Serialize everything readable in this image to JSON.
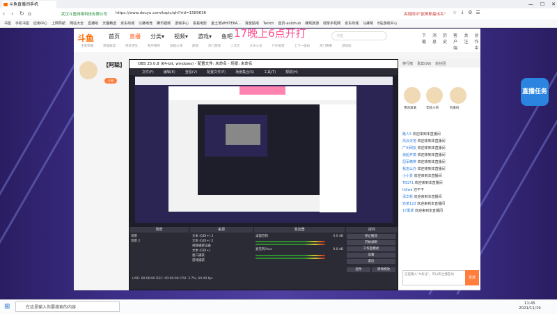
{
  "browser": {
    "tab_title": "斗鱼直播间手机",
    "secure_label": "武汉斗鱼网络科技有限公司",
    "url": "https://www.douyu.com/topic/qhl?rid=1589636",
    "right_notice": "央视回评\"欧美斯最出名\"",
    "window_controls": [
      "—",
      "☐",
      "✕"
    ],
    "nav_icons": [
      "‹",
      "›",
      "↻",
      "⌂"
    ],
    "toolbar_icons": [
      "☆",
      "↓",
      "⚙",
      "☰"
    ]
  },
  "bookmarks": [
    "书签",
    "手机书签",
    "应用中心",
    "上网导航",
    "网站大全",
    "直播吧",
    "天猫精选",
    "京东商城",
    "公路电竞",
    "腾讯视频",
    "游戏中心",
    "看看电影",
    "金土地WHITEKA...",
    "百度贴吧",
    "Twitch",
    "首页-autohub",
    "蜂窝旅游",
    "绿茶手机网",
    "京东商城",
    "马蜂窝",
    "B站游戏中心"
  ],
  "douyu": {
    "logo": "斗鱼",
    "overlay_text": "17晚上6点开打",
    "nav": [
      "首页",
      "直播",
      "分类▾",
      "视频▾",
      "游戏▾",
      "鱼吧"
    ],
    "active_nav": "直播",
    "search_placeholder": "卡位",
    "right_nav": [
      "下载",
      "消息",
      "历史",
      "客户端",
      "关注",
      "创作中心"
    ],
    "sub_nav": [
      "王者荣耀",
      "英雄联盟",
      "绝地求生",
      "和平精英",
      "穿越火线",
      "颜值",
      "热门游戏",
      "二次元",
      "大乐斗龙",
      "户外旅游",
      "上下一级站",
      "热门赛事",
      "游戏站"
    ]
  },
  "room": {
    "streamer_name": "【阿聪】",
    "follow_button": "订阅"
  },
  "obs": {
    "title": "OBS 25.0.8 (64-bit, windows) - 配置文件: 未命名 - 场景: 未命名",
    "menu": [
      "文件(F)",
      "编辑(E)",
      "查看(V)",
      "配置文件(P)",
      "场景集合(S)",
      "工具(T)",
      "帮助(H)"
    ],
    "panel_titles": [
      "场景",
      "来源",
      "混音器",
      "控件"
    ],
    "scenes": [
      "场景",
      "场景 2"
    ],
    "sources": [
      "文本 (GDI+) 3",
      "文本 (GDI+) 2",
      "视频捕获设备",
      "文本 (GDI+)",
      "窗口捕获",
      "游戏捕获"
    ],
    "mixer": [
      {
        "name": "桌面音频",
        "level": "0.0 dB"
      },
      {
        "name": "麦克风/Aux",
        "level": "0.0 dB"
      }
    ],
    "controls": [
      "停止推流",
      "开始录制",
      "工作室模式",
      "设置",
      "退出"
    ],
    "transition_tabs": [
      "控件",
      "转场特效"
    ],
    "status": "LIVE: 00:00:00   REC: 00:00:00   CPU: 3.7%, 60.00 fps"
  },
  "right_panel": {
    "tabs": [
      "排行榜",
      "贵宾(99)",
      "粉丝团"
    ],
    "badge_text": "直播任务",
    "fans": [
      "雪冰滚滚",
      "年轻人的",
      "有爱的"
    ]
  },
  "chat": [
    {
      "nick": "路人5",
      "text": "欢迎来到本直播间"
    },
    {
      "nick": "风云天地",
      "text": "欢迎来到本直播间"
    },
    {
      "nick": "广州网友",
      "text": "欢迎来到本直播间"
    },
    {
      "nick": "浪起开搞",
      "text": "欢迎来到本直播间"
    },
    {
      "nick": "冠军精英",
      "text": "欢迎来到本直播间"
    },
    {
      "nick": "我怎么办",
      "text": "欢迎来到本直播间"
    },
    {
      "nick": "小小爱",
      "text": "欢迎来到本直播间"
    },
    {
      "nick": "TB171",
      "text": "欢迎来到本直播间"
    },
    {
      "nick": "lidiwa",
      "text": "还不干"
    },
    {
      "nick": "清华新",
      "text": "欢迎来到本直播间"
    },
    {
      "nick": "奶茶123",
      "text": "欢迎来到本直播间"
    },
    {
      "nick": "17夏季",
      "text": "欢迎来到本直播间"
    }
  ],
  "chat_input_placeholder": "这里输入\"#关注\"，可以和主播互动",
  "send_button": "发送",
  "taskbar": {
    "search_placeholder": "在这里输入你要搜索的内容",
    "time": "11:45",
    "date": "2021/11/19"
  },
  "colors": {
    "brand": "#ff5d23",
    "overlay": "#ff4e8f",
    "page_bg": "#2b1d62"
  }
}
